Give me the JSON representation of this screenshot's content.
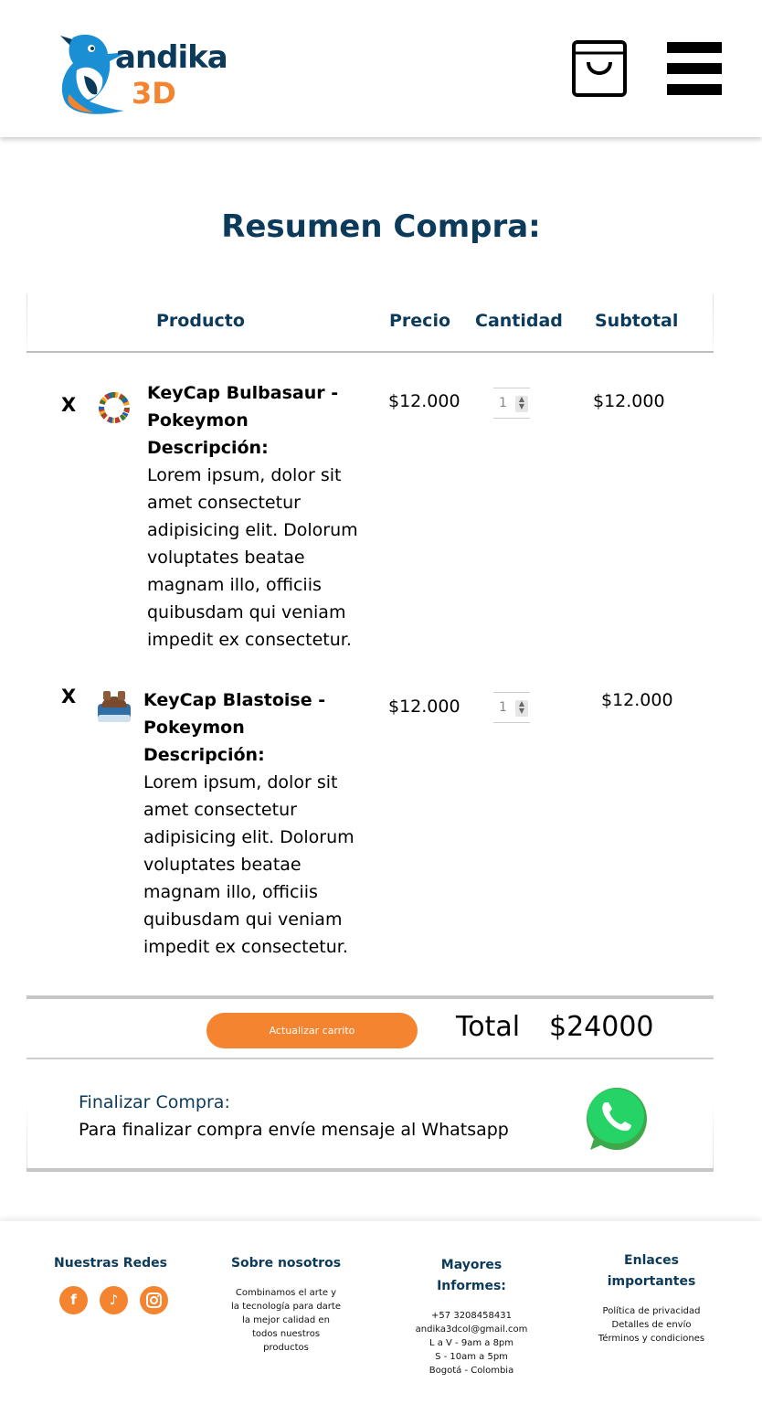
{
  "brand": {
    "name": "andika",
    "suffix": "3D",
    "accent": "#f58430",
    "primary": "#0b3a5b"
  },
  "header": {
    "cart_icon": "shopping-bag-icon",
    "menu_icon": "hamburger-menu-icon"
  },
  "page": {
    "title": "Resumen Compra:"
  },
  "table": {
    "headers": {
      "product": "Producto",
      "price": "Precio",
      "quantity": "Cantidad",
      "subtotal": "Subtotal"
    },
    "items": [
      {
        "remove": "X",
        "name": "KeyCap Bulbasaur - Pokeymon",
        "desc_label": "Descripción:",
        "description": "Lorem ipsum, dolor sit amet consectetur adipisicing elit. Dolorum voluptates beatae magnam illo, officiis quibusdam qui veniam impedit ex consectetur.",
        "price": "$12.000",
        "quantity": "1",
        "subtotal": "$12.000"
      },
      {
        "remove": "X",
        "name": "KeyCap Blastoise - Pokeymon",
        "desc_label": "Descripción:",
        "description": "Lorem ipsum, dolor sit amet consectetur adipisicing elit. Dolorum voluptates beatae magnam illo, officiis quibusdam qui veniam impedit ex consectetur.",
        "price": "$12.000",
        "quantity": "1",
        "subtotal": "$12.000"
      }
    ]
  },
  "cart": {
    "update_label": "Actualizar carrito",
    "total_label": "Total",
    "total_value": "$24000"
  },
  "finalize": {
    "title": "Finalizar Compra:",
    "text": "Para finalizar compra envíe mensaje al Whatsapp",
    "icon": "whatsapp-icon"
  },
  "footer": {
    "social": {
      "title": "Nuestras Redes",
      "icons": [
        "facebook-icon",
        "tiktok-icon",
        "instagram-icon"
      ]
    },
    "about": {
      "title": "Sobre nosotros",
      "lines": [
        "Combinamos el arte y",
        "la tecnología para darte",
        "la mejor calidad en",
        "todos nuestros",
        "productos"
      ]
    },
    "info": {
      "title_1": "Mayores",
      "title_2": "Informes:",
      "lines": [
        "+57 3208458431",
        "andika3dcol@gmail.com",
        "L a V - 9am a 8pm",
        "S - 10am a 5pm",
        "Bogotá - Colombia"
      ]
    },
    "links": {
      "title_1": "Enlaces",
      "title_2": "importantes",
      "items": [
        "Política de privacidad",
        "Detalles de envío",
        "Términos y condiciones"
      ]
    }
  }
}
